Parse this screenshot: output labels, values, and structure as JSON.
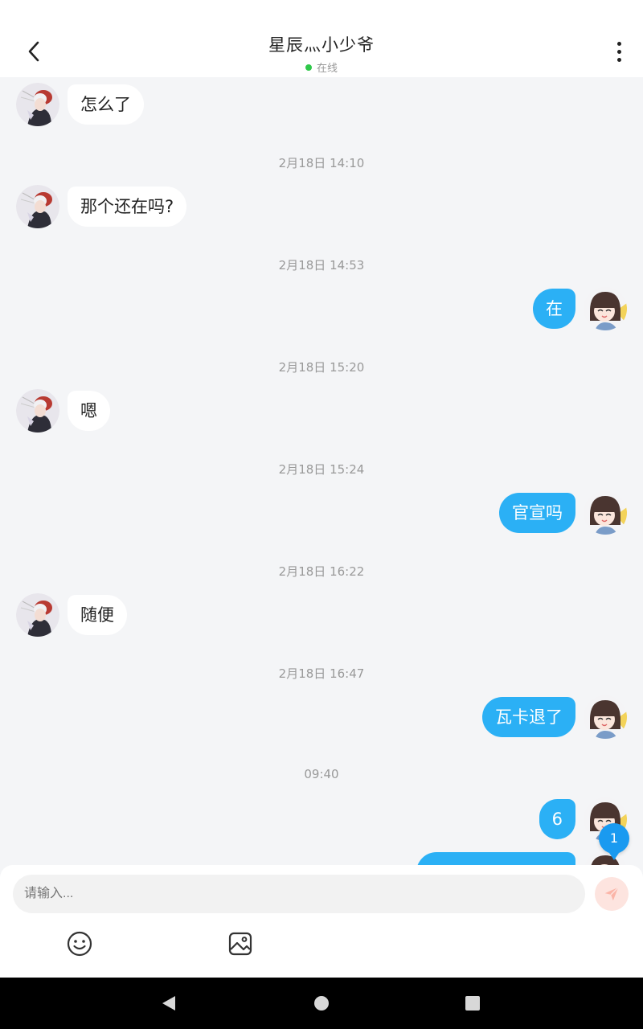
{
  "header": {
    "title": "星辰灬小少爷",
    "status": "在线",
    "back_icon": "chevron-left-icon",
    "more_icon": "more-vertical-icon"
  },
  "messages": [
    {
      "side": "left",
      "text": "怎么了"
    },
    {
      "time": "2月18日 14:10"
    },
    {
      "side": "left",
      "text": "那个还在吗?"
    },
    {
      "time": "2月18日 14:53"
    },
    {
      "side": "right",
      "text": "在"
    },
    {
      "time": "2月18日 15:20"
    },
    {
      "side": "left",
      "text": "嗯"
    },
    {
      "time": "2月18日 15:24"
    },
    {
      "side": "right",
      "text": "官宣吗"
    },
    {
      "time": "2月18日 16:22"
    },
    {
      "side": "left",
      "text": "随便"
    },
    {
      "time": "2月18日 16:47"
    },
    {
      "side": "right",
      "text": "瓦卡退了"
    },
    {
      "time": "09:40"
    },
    {
      "side": "right",
      "text": "6"
    }
  ],
  "unread_badge": "1",
  "input": {
    "placeholder": "请输入..."
  },
  "toolbar": {
    "emoji_icon": "emoji-icon",
    "image_icon": "image-icon",
    "send_icon": "send-icon"
  },
  "colors": {
    "accent": "#2bb0f5",
    "badge": "#1a9af0",
    "online": "#2fc84a",
    "send_disabled": "#fde4df"
  }
}
